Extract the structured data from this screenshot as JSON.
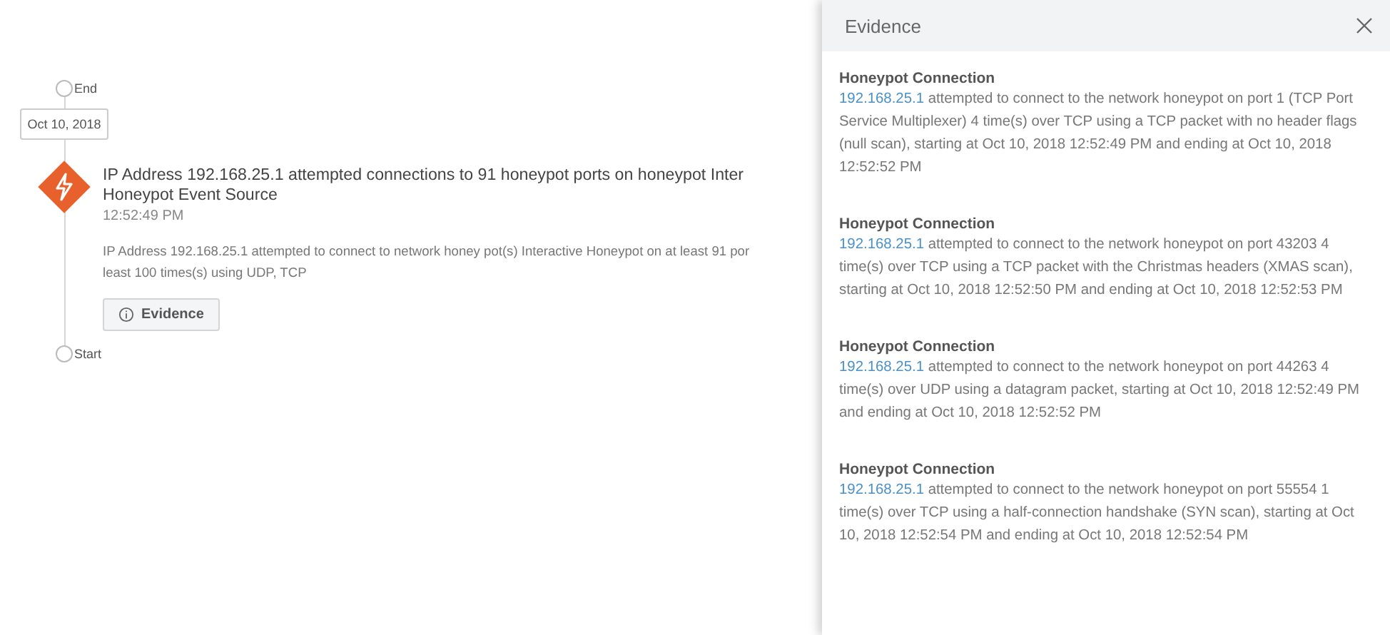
{
  "timeline": {
    "end_label": "End",
    "date": "Oct 10, 2018",
    "event": {
      "title_lines": [
        "IP Address 192.168.25.1 attempted connections to 91 honeypot ports on honeypot Inter",
        "Honeypot Event Source"
      ],
      "time": "12:52:49 PM",
      "description_lines": [
        "IP Address 192.168.25.1 attempted to connect to network honey pot(s) Interactive Honeypot on at least 91 por",
        "least 100 times(s) using UDP, TCP"
      ],
      "button": "Evidence"
    },
    "start_label": "Start"
  },
  "panel": {
    "title": "Evidence",
    "items": [
      {
        "title": "Honeypot Connection",
        "address": "192.168.25.1",
        "text": " attempted to connect to the network honeypot on port 1 (TCP Port Service Multiplexer) 4 time(s) over TCP using a TCP packet with no header flags (null scan), starting at Oct 10, 2018 12:52:49 PM and ending at Oct 10, 2018 12:52:52 PM"
      },
      {
        "title": "Honeypot Connection",
        "address": "192.168.25.1",
        "text": " attempted to connect to the network honeypot on port 43203 4 time(s) over TCP using a TCP packet with the Christmas headers (XMAS scan), starting at Oct 10, 2018 12:52:50 PM and ending at Oct 10, 2018 12:52:53 PM"
      },
      {
        "title": "Honeypot Connection",
        "address": "192.168.25.1",
        "text": " attempted to connect to the network honeypot on port 44263 4 time(s) over UDP using a datagram packet, starting at Oct 10, 2018 12:52:49 PM and ending at Oct 10, 2018 12:52:52 PM"
      },
      {
        "title": "Honeypot Connection",
        "address": "192.168.25.1",
        "text": " attempted to connect to the network honeypot on port 55554 1 time(s) over TCP using a half-connection handshake (SYN scan), starting at Oct 10, 2018 12:52:54 PM and ending at Oct 10, 2018 12:52:54 PM"
      }
    ]
  }
}
